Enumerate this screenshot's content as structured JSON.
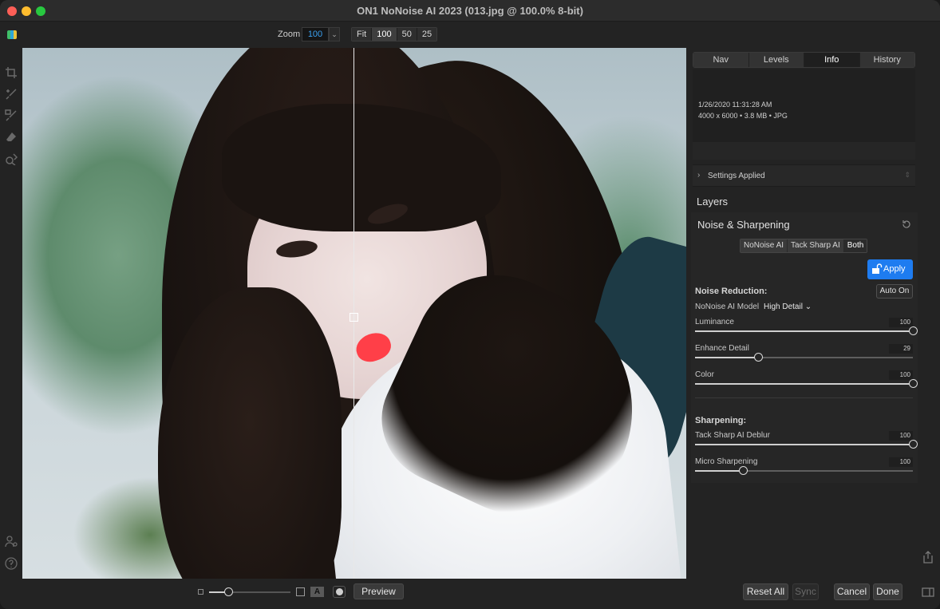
{
  "window": {
    "title": "ON1 NoNoise AI 2023 (013.jpg @ 100.0% 8-bit)"
  },
  "toolbar": {
    "zoom_label": "Zoom",
    "zoom_value": "100",
    "zoom_presets": [
      "Fit",
      "100",
      "50",
      "25"
    ]
  },
  "tools": [
    "crop-icon",
    "brush-icon",
    "mask-brush-icon",
    "eraser-icon",
    "zoom-tool-icon"
  ],
  "bottom": {
    "preview_label": "Preview",
    "view_a_label": "A",
    "reset_all_label": "Reset All",
    "sync_label": "Sync",
    "cancel_label": "Cancel",
    "done_label": "Done",
    "zoom_slider_level": 0.2
  },
  "panel": {
    "tabs": [
      "Nav",
      "Levels",
      "Info",
      "History"
    ],
    "active_tab": "Info",
    "info": {
      "date": "1/26/2020 11:31:28 AM",
      "details": "4000 x 6000 • 3.8 MB • JPG"
    },
    "settings_applied_label": "Settings Applied",
    "layers_label": "Layers",
    "noise_sharpening": {
      "title": "Noise & Sharpening",
      "modes": [
        "NoNoise AI",
        "Tack Sharp AI",
        "Both"
      ],
      "active_mode": "Both",
      "apply_label": "Apply",
      "noise_reduction_label": "Noise Reduction:",
      "auto_on_label": "Auto On",
      "model_label": "NoNoise AI Model",
      "model_value": "High Detail ⌄",
      "sliders": [
        {
          "label": "Luminance",
          "value": 100
        },
        {
          "label": "Enhance Detail",
          "value": 29
        },
        {
          "label": "Color",
          "value": 100
        }
      ],
      "sharpening_label": "Sharpening:",
      "sharpening_sliders": [
        {
          "label": "Tack Sharp AI Deblur",
          "value": 100
        },
        {
          "label": "Micro Sharpening",
          "value": 100,
          "shown_level": 0.22
        }
      ]
    }
  },
  "colors": {
    "accent_blue": "#1e7cf0",
    "zoom_text": "#3aa0f0",
    "lips": "#ff3f48"
  }
}
